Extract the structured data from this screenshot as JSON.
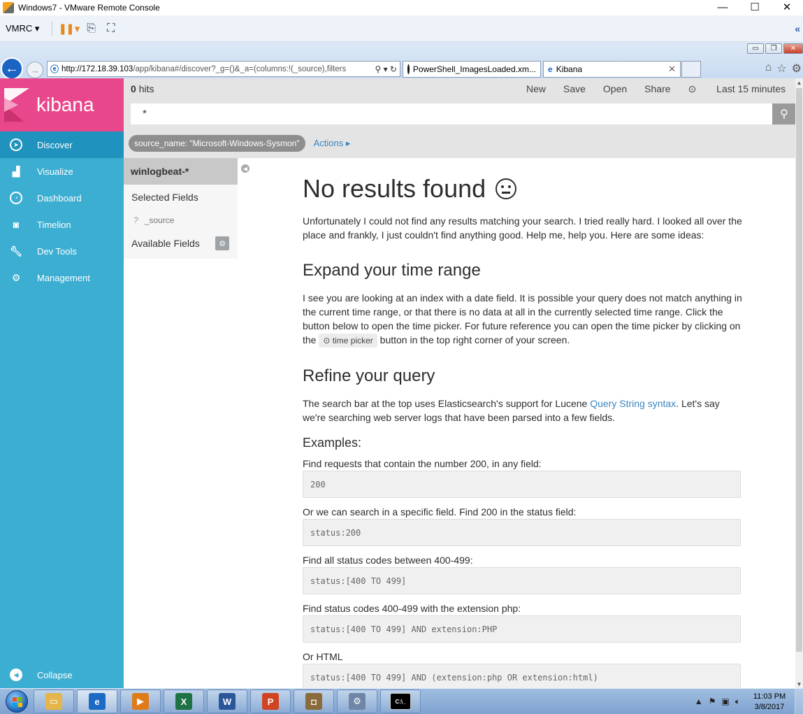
{
  "window": {
    "title": "Windows7 - VMware Remote Console",
    "controls": [
      "—",
      "☐",
      "✕"
    ]
  },
  "vmrc": {
    "menu_label": "VMRC ▾",
    "pause_label": "❚❚ ▾"
  },
  "browser": {
    "url_host": "http://172.18.39.103",
    "url_path": "/app/kibana#/discover?_g=()&_a=(columns:!(_source),filters",
    "addr_buttons": "⚲ ▾ ↻",
    "tabs": [
      {
        "label": "PowerShell_ImagesLoaded.xm...",
        "icon": "github-icon"
      },
      {
        "label": "Kibana",
        "icon": "ie-icon"
      }
    ]
  },
  "kibana": {
    "logo_text": "kibana",
    "nav": [
      {
        "label": "Discover",
        "icon": "compass-icon",
        "active": true
      },
      {
        "label": "Visualize",
        "icon": "bar-chart-icon"
      },
      {
        "label": "Dashboard",
        "icon": "dashboard-icon"
      },
      {
        "label": "Timelion",
        "icon": "timelion-icon"
      },
      {
        "label": "Dev Tools",
        "icon": "wrench-icon"
      },
      {
        "label": "Management",
        "icon": "gear-icon"
      }
    ],
    "collapse_label": "Collapse",
    "hits_count": "0",
    "hits_label": "hits",
    "top_menu": {
      "new": "New",
      "save": "Save",
      "open": "Open",
      "share": "Share",
      "time": "Last 15 minutes"
    },
    "query": "*",
    "filter_pill": "source_name: \"Microsoft-Windows-Sysmon\"",
    "actions_label": "Actions ▸",
    "index_pattern": "winlogbeat-*",
    "selected_fields_label": "Selected Fields",
    "selected_field": "_source",
    "selected_field_type": "?",
    "available_fields_label": "Available Fields",
    "no_results": {
      "title": "No results found",
      "intro": "Unfortunately I could not find any results matching your search. I tried really hard. I looked all over the place and frankly, I just couldn't find anything good. Help me, help you. Here are some ideas:",
      "expand_heading": "Expand your time range",
      "expand_text_1": "I see you are looking at an index with a date field. It is possible your query does not match anything in the current time range, or that there is no data at all in the currently selected time range. Click the button below to open the time picker. For future reference you can open the time picker by clicking on the ",
      "time_picker_label": "time picker",
      "expand_text_2": " button in the top right corner of your screen.",
      "refine_heading": "Refine your query",
      "refine_text_1": "The search bar at the top uses Elasticsearch's support for Lucene ",
      "refine_link": "Query String syntax",
      "refine_text_2": ". Let's say we're searching web server logs that have been parsed into a few fields.",
      "examples_heading": "Examples:",
      "examples": [
        {
          "label": "Find requests that contain the number 200, in any field:",
          "code": "200"
        },
        {
          "label": "Or we can search in a specific field. Find 200 in the status field:",
          "code": "status:200"
        },
        {
          "label": "Find all status codes between 400-499:",
          "code": "status:[400 TO 499]"
        },
        {
          "label": "Find status codes 400-499 with the extension php:",
          "code": "status:[400 TO 499] AND extension:PHP"
        },
        {
          "label": "Or HTML",
          "code": "status:[400 TO 499] AND (extension:php OR extension:html)"
        }
      ]
    }
  },
  "taskbar": {
    "apps": [
      {
        "name": "explorer",
        "glyph": "▭",
        "color": "#e3b54a"
      },
      {
        "name": "internet-explorer",
        "glyph": "e",
        "color": "#1b6ac4"
      },
      {
        "name": "media-player",
        "glyph": "▶",
        "color": "#e07b1a"
      },
      {
        "name": "excel",
        "glyph": "X",
        "color": "#1f7244"
      },
      {
        "name": "word",
        "glyph": "W",
        "color": "#2b579a"
      },
      {
        "name": "powerpoint",
        "glyph": "P",
        "color": "#d04423"
      },
      {
        "name": "security",
        "glyph": "◘",
        "color": "#8a6b3c"
      },
      {
        "name": "settings",
        "glyph": "⚙",
        "color": "#6f86a6"
      },
      {
        "name": "cmd",
        "glyph": "C:\\_",
        "color": "#000000"
      }
    ],
    "clock_time": "11:03 PM",
    "clock_date": "3/8/2017"
  }
}
